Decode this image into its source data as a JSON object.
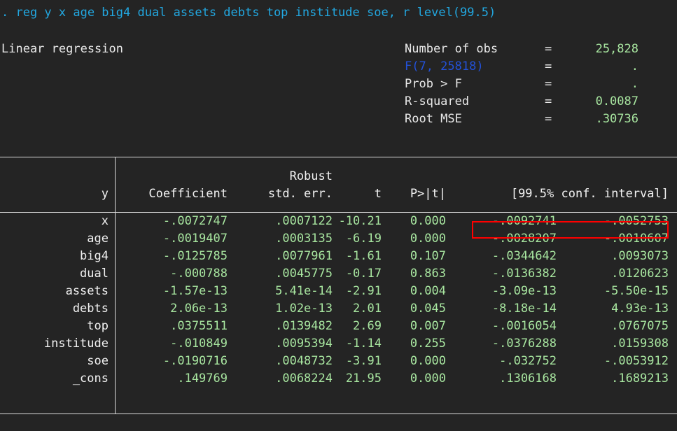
{
  "terminal": {
    "background": "#242424",
    "command_prompt": ".",
    "command": "reg y x age big4 dual assets debts top institude soe, r level(99.5)",
    "command_color": "#22a7e0",
    "value_color": "#a8e6a0",
    "link_color": "#2351d8",
    "highlight_color": "#ff0000"
  },
  "model": {
    "title": "Linear regression"
  },
  "stats": [
    {
      "label": "Number of obs",
      "eq": "=",
      "value": "25,828",
      "is_link": false
    },
    {
      "label": "F(7, 25818)",
      "eq": "=",
      "value": ".",
      "is_link": true
    },
    {
      "label": "Prob > F",
      "eq": "=",
      "value": ".",
      "is_link": false
    },
    {
      "label": "R-squared",
      "eq": "=",
      "value": "0.0087",
      "is_link": false
    },
    {
      "label": "Root MSE",
      "eq": "=",
      "value": ".30736",
      "is_link": false
    }
  ],
  "table": {
    "depvar": "y",
    "robust_label": "Robust",
    "headers": {
      "coefficient": "Coefficient",
      "std_err": "std. err.",
      "t": "t",
      "p": "P>|t|",
      "conf_interval": "[99.5% conf. interval]"
    },
    "rows": [
      {
        "name": "x",
        "coef": "-.0072747",
        "se": ".0007122",
        "t": "-10.21",
        "p": "0.000",
        "ci_lo": "-.0092741",
        "ci_hi": "-.0052753",
        "highlighted": true
      },
      {
        "name": "age",
        "coef": "-.0019407",
        "se": ".0003135",
        "t": "-6.19",
        "p": "0.000",
        "ci_lo": "-.0028207",
        "ci_hi": "-.0010607",
        "highlighted": false
      },
      {
        "name": "big4",
        "coef": "-.0125785",
        "se": ".0077961",
        "t": "-1.61",
        "p": "0.107",
        "ci_lo": "-.0344642",
        "ci_hi": ".0093073",
        "highlighted": false
      },
      {
        "name": "dual",
        "coef": "-.000788",
        "se": ".0045775",
        "t": "-0.17",
        "p": "0.863",
        "ci_lo": "-.0136382",
        "ci_hi": ".0120623",
        "highlighted": false
      },
      {
        "name": "assets",
        "coef": "-1.57e-13",
        "se": "5.41e-14",
        "t": "-2.91",
        "p": "0.004",
        "ci_lo": "-3.09e-13",
        "ci_hi": "-5.50e-15",
        "highlighted": false
      },
      {
        "name": "debts",
        "coef": "2.06e-13",
        "se": "1.02e-13",
        "t": "2.01",
        "p": "0.045",
        "ci_lo": "-8.18e-14",
        "ci_hi": "4.93e-13",
        "highlighted": false
      },
      {
        "name": "top",
        "coef": ".0375511",
        "se": ".0139482",
        "t": "2.69",
        "p": "0.007",
        "ci_lo": "-.0016054",
        "ci_hi": ".0767075",
        "highlighted": false
      },
      {
        "name": "institude",
        "coef": "-.010849",
        "se": ".0095394",
        "t": "-1.14",
        "p": "0.255",
        "ci_lo": "-.0376288",
        "ci_hi": ".0159308",
        "highlighted": false
      },
      {
        "name": "soe",
        "coef": "-.0190716",
        "se": ".0048732",
        "t": "-3.91",
        "p": "0.000",
        "ci_lo": "-.032752",
        "ci_hi": "-.0053912",
        "highlighted": false
      },
      {
        "name": "_cons",
        "coef": ".149769",
        "se": ".0068224",
        "t": "21.95",
        "p": "0.000",
        "ci_lo": ".1306168",
        "ci_hi": ".1689213",
        "highlighted": false
      }
    ]
  }
}
